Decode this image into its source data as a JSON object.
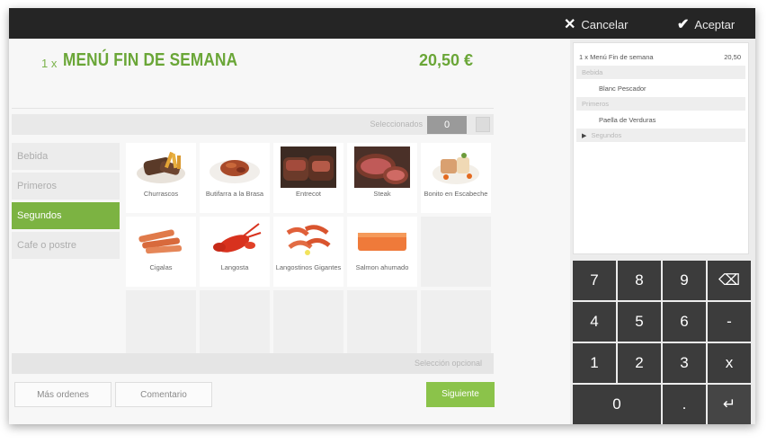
{
  "topbar": {
    "cancel_label": "Cancelar",
    "accept_label": "Aceptar",
    "cancel_icon": "close-icon",
    "accept_icon": "check-icon"
  },
  "header": {
    "quantity": "1 x",
    "title": "MENÚ FIN DE SEMANA",
    "price": "20,50 €"
  },
  "selection": {
    "label": "Seleccionados",
    "count": "0"
  },
  "categories": [
    {
      "label": "Bebida",
      "active": false
    },
    {
      "label": "Primeros",
      "active": false
    },
    {
      "label": "Segundos",
      "active": true
    },
    {
      "label": "Cafe o postre",
      "active": false
    }
  ],
  "products": [
    {
      "label": "Churrascos",
      "icon": "churrasco-photo"
    },
    {
      "label": "Butifarra a la Brasa",
      "icon": "butifarra-photo"
    },
    {
      "label": "Entrecot",
      "icon": "entrecot-photo"
    },
    {
      "label": "Steak",
      "icon": "steak-photo"
    },
    {
      "label": "Bonito en Escabeche",
      "icon": "bonito-photo"
    },
    {
      "label": "Cigalas",
      "icon": "cigalas-photo"
    },
    {
      "label": "Langosta",
      "icon": "langosta-photo"
    },
    {
      "label": "Langostinos Gigantes",
      "icon": "langostinos-photo"
    },
    {
      "label": "Salmon ahumado",
      "icon": "salmon-photo"
    }
  ],
  "optional_label": "Selección opcional",
  "actions": {
    "more_orders": "Más ordenes",
    "comment": "Comentario",
    "next": "Siguiente"
  },
  "summary": {
    "title": "1 x Menú Fin de semana",
    "price": "20,50",
    "sections": [
      {
        "label": "Bebida",
        "item": "Blanc Pescador"
      },
      {
        "label": "Primeros",
        "item": "Paella de Verduras"
      },
      {
        "label": "Segundos",
        "item": ""
      }
    ]
  },
  "keypad": {
    "keys": [
      "7",
      "8",
      "9",
      "⌫",
      "4",
      "5",
      "6",
      "-",
      "1",
      "2",
      "3",
      "x",
      "0",
      ".",
      "↵"
    ]
  },
  "colors": {
    "accent_green": "#7cb342",
    "topbar": "#252525",
    "key": "#3c3c3c"
  }
}
